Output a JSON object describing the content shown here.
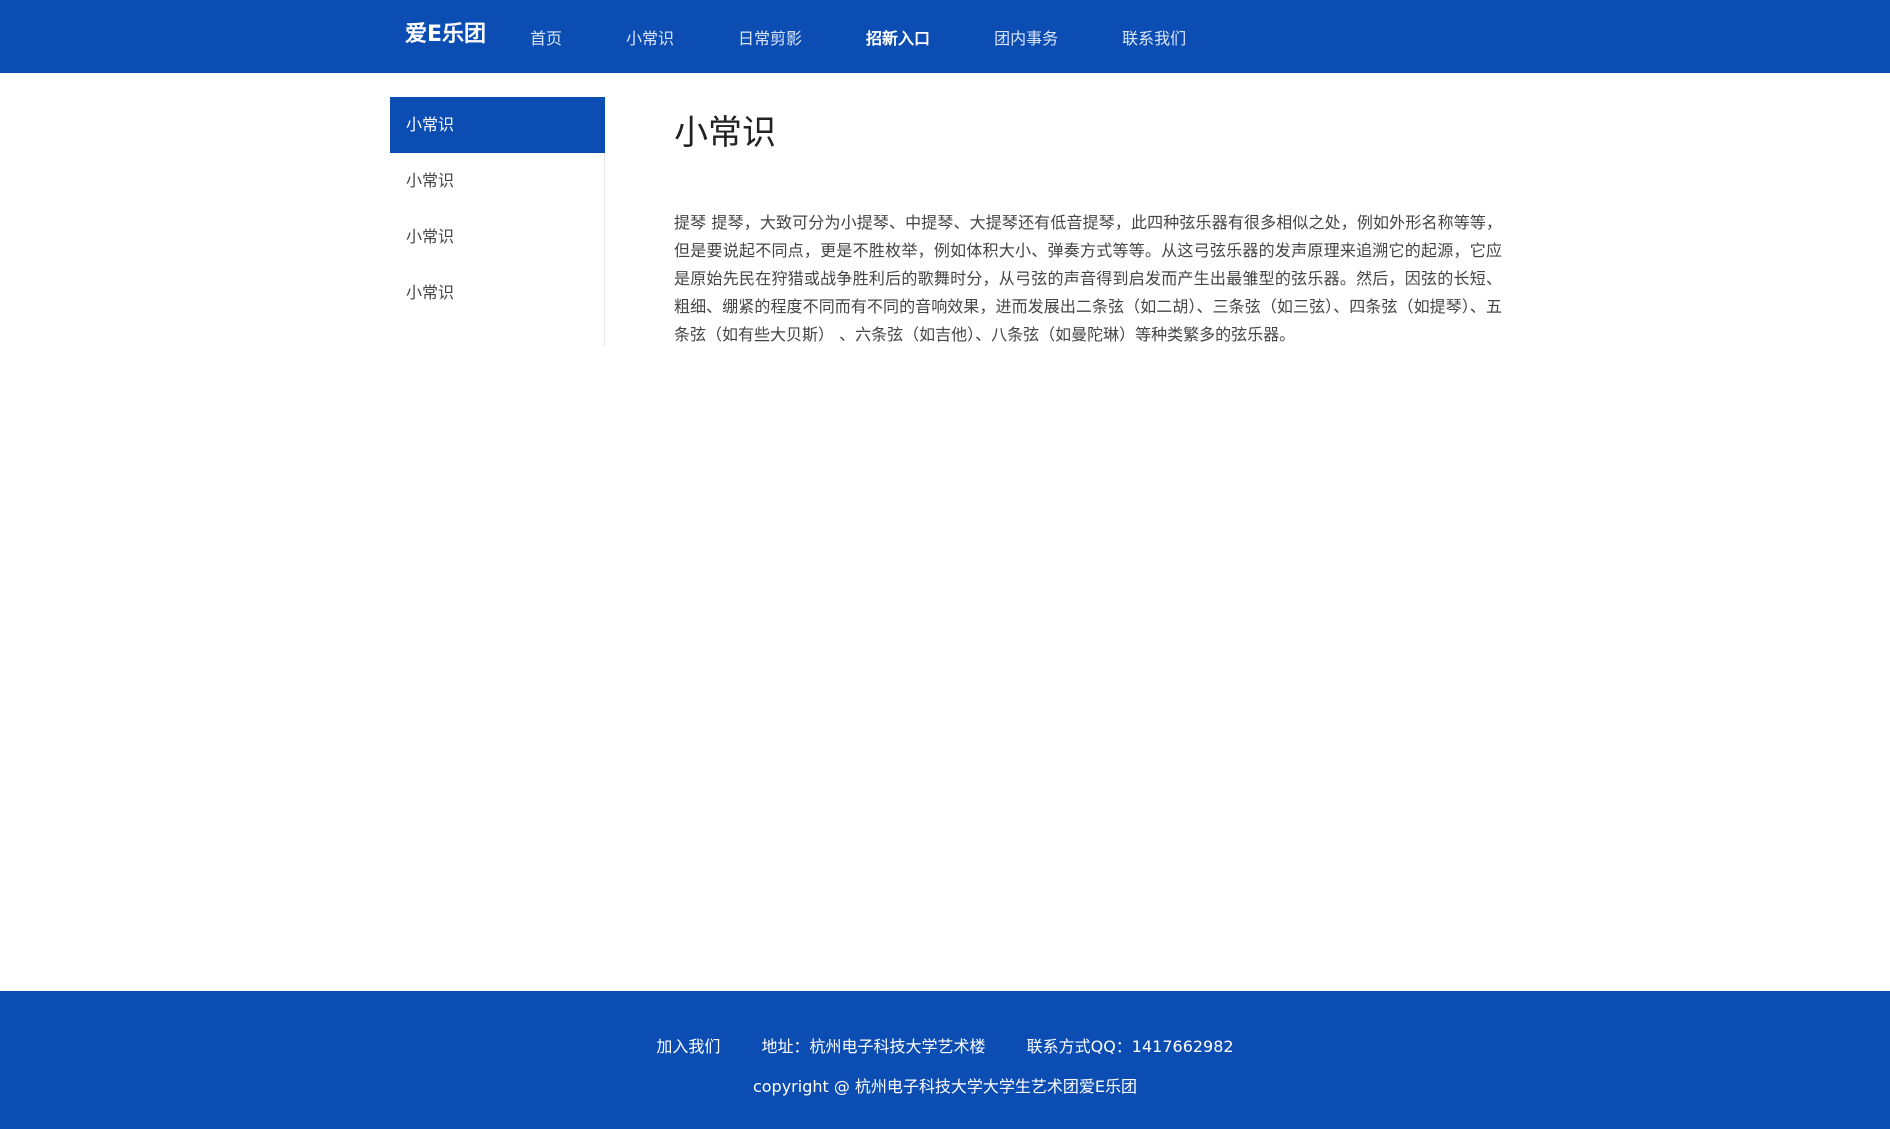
{
  "header": {
    "brand": "爱E乐团",
    "nav": [
      {
        "label": "首页",
        "active": false
      },
      {
        "label": "小常识",
        "active": false
      },
      {
        "label": "日常剪影",
        "active": false
      },
      {
        "label": "招新入口",
        "active": true
      },
      {
        "label": "团内事务",
        "active": false
      },
      {
        "label": "联系我们",
        "active": false
      }
    ]
  },
  "sidebar": {
    "items": [
      {
        "label": "小常识",
        "active": true
      },
      {
        "label": "小常识",
        "active": false
      },
      {
        "label": "小常识",
        "active": false
      },
      {
        "label": "小常识",
        "active": false
      }
    ]
  },
  "main": {
    "title": "小常识",
    "body": "提琴 提琴，大致可分为小提琴、中提琴、大提琴还有低音提琴，此四种弦乐器有很多相似之处，例如外形名称等等，但是要说起不同点，更是不胜枚举，例如体积大小、弹奏方式等等。从这弓弦乐器的发声原理来追溯它的起源，它应是原始先民在狩猎或战争胜利后的歌舞时分，从弓弦的声音得到启发而产生出最雏型的弦乐器。然后，因弦的长短、粗细、绷紧的程度不同而有不同的音响效果，进而发展出二条弦（如二胡）、三条弦（如三弦）、四条弦（如提琴）、五条弦（如有些大贝斯） 、六条弦（如吉他）、八条弦（如曼陀琳）等种类繁多的弦乐器。"
  },
  "footer": {
    "join": "加入我们",
    "address": "地址：杭州电子科技大学艺术楼",
    "contact": "联系方式QQ：1417662982",
    "copyright": "copyright @ 杭州电子科技大学大学生艺术团爱E乐团"
  },
  "colors": {
    "primary": "#0b4db3",
    "background": "#ffffff",
    "text": "#444444"
  }
}
